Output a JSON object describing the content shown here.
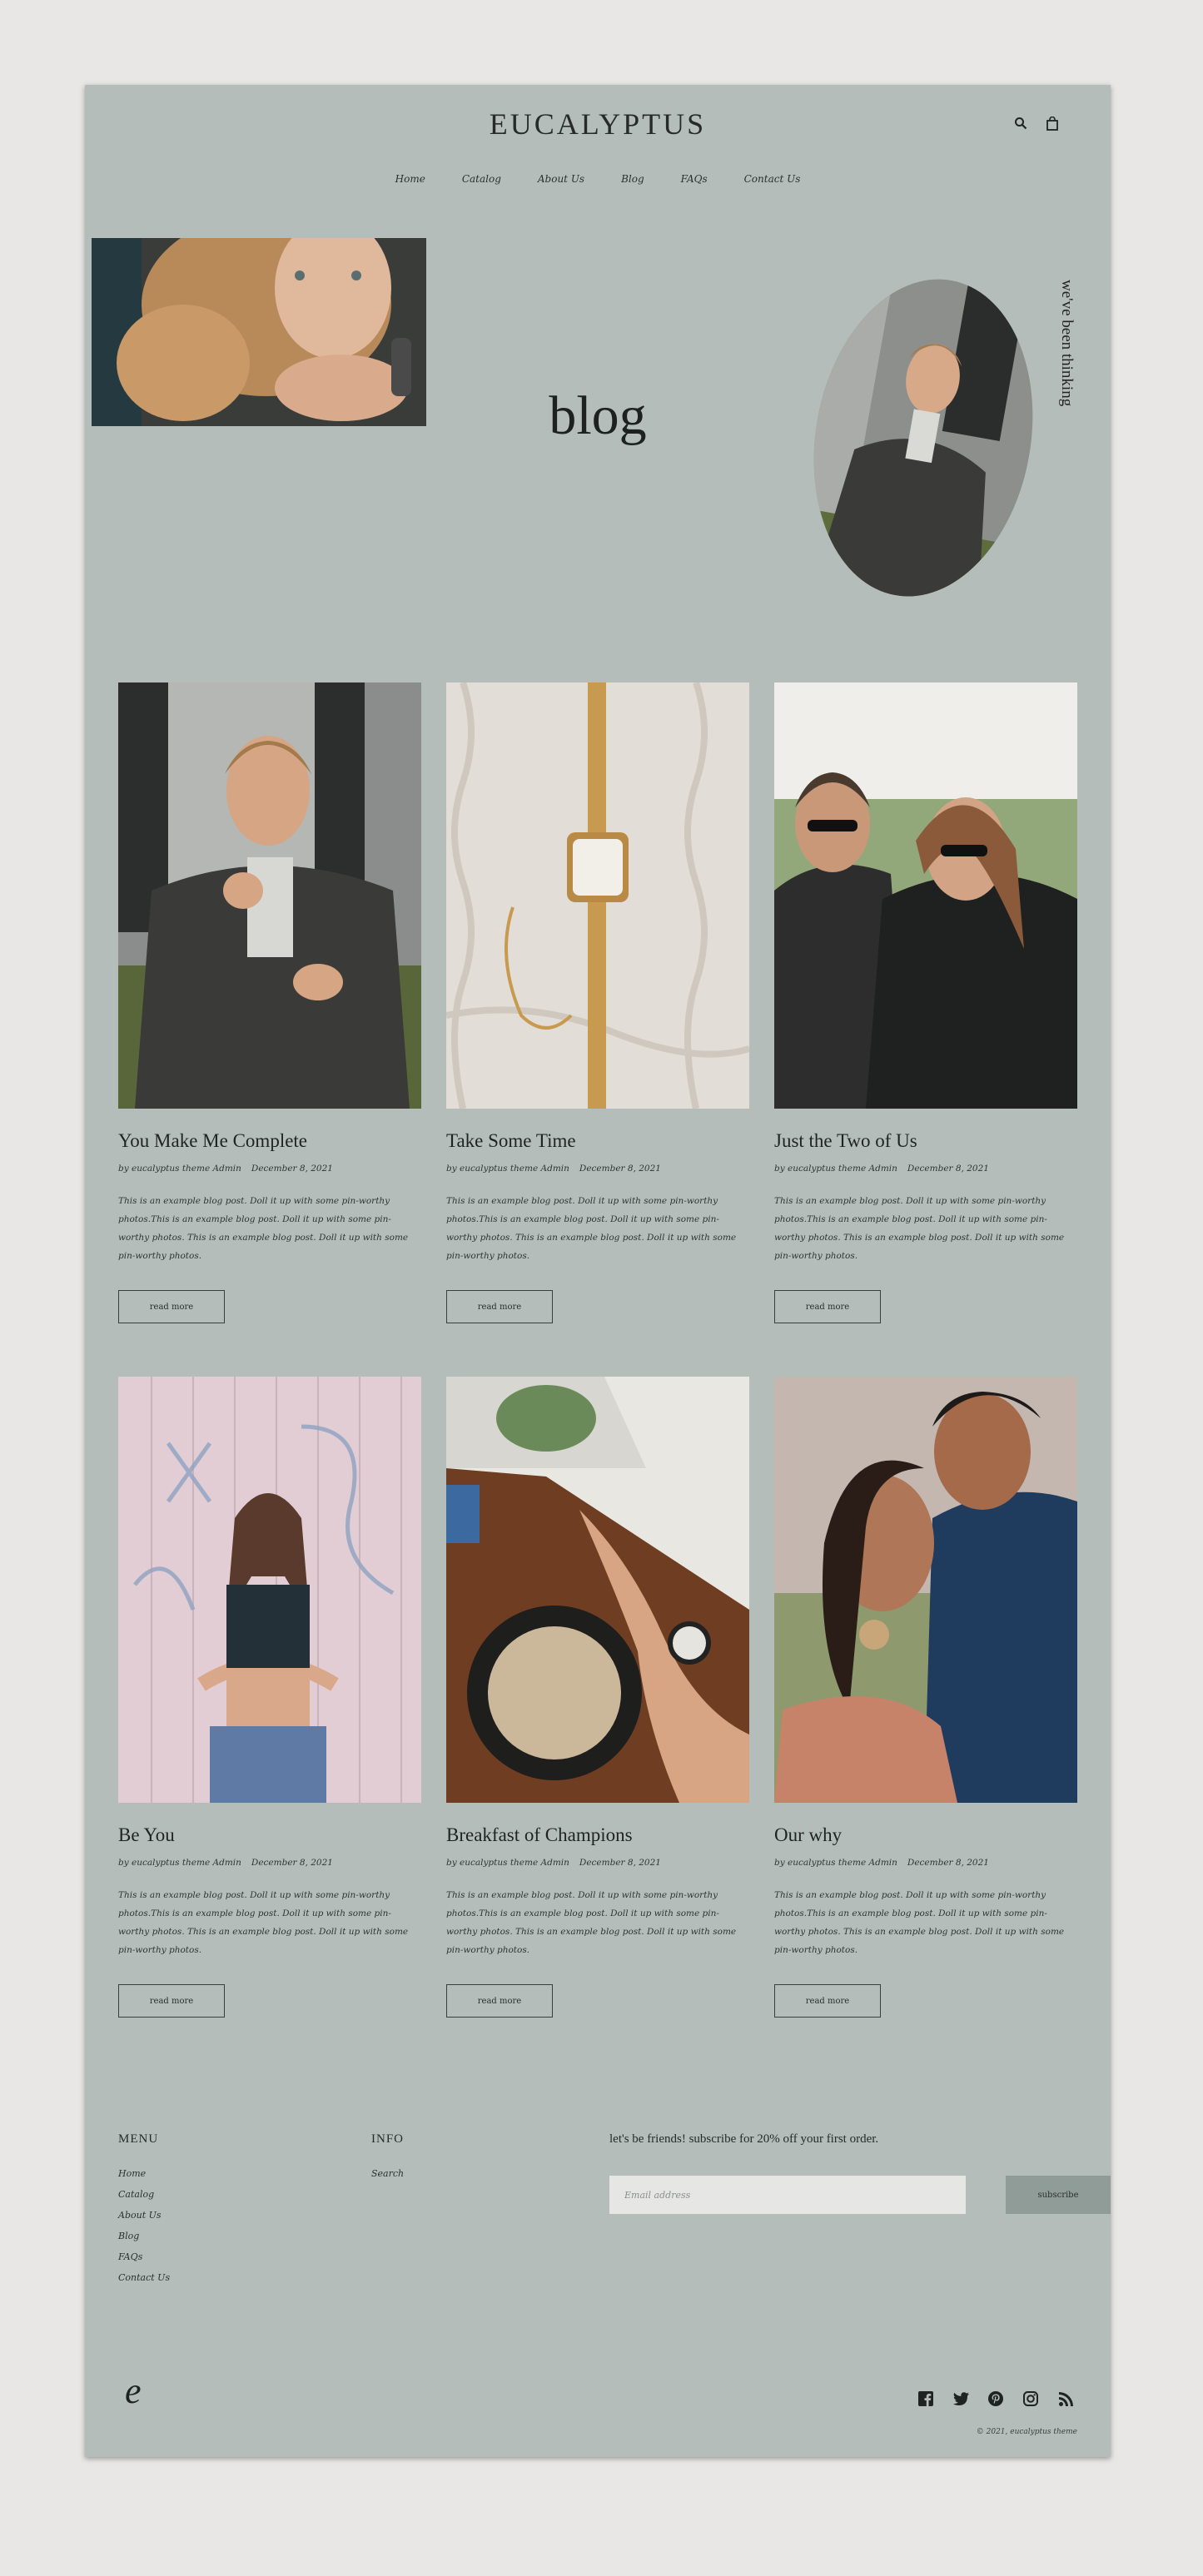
{
  "header": {
    "logo": "EUCALYPTUS",
    "nav": [
      "Home",
      "Catalog",
      "About Us",
      "Blog",
      "FAQs",
      "Contact Us"
    ]
  },
  "hero": {
    "title": "blog",
    "side_text": "we've been thinking"
  },
  "posts": [
    {
      "title": "You Make Me Complete",
      "author": "by eucalyptus theme Admin",
      "date": "December 8, 2021",
      "excerpt": "This is an example blog post. Doll it up with some pin-worthy photos.This is an example blog post. Doll it up with some pin-worthy photos. This is an example blog post. Doll it up with some pin-worthy photos.",
      "button": "read more"
    },
    {
      "title": "Take Some Time",
      "author": "by eucalyptus theme Admin",
      "date": "December 8, 2021",
      "excerpt": "This is an example blog post. Doll it up with some pin-worthy photos.This is an example blog post. Doll it up with some pin-worthy photos. This is an example blog post. Doll it up with some pin-worthy photos.",
      "button": "read more"
    },
    {
      "title": "Just the Two of Us",
      "author": "by eucalyptus theme Admin",
      "date": "December 8, 2021",
      "excerpt": "This is an example blog post. Doll it up with some pin-worthy photos.This is an example blog post. Doll it up with some pin-worthy photos. This is an example blog post. Doll it up with some pin-worthy photos.",
      "button": "read more"
    },
    {
      "title": "Be You",
      "author": "by eucalyptus theme Admin",
      "date": "December 8, 2021",
      "excerpt": "This is an example blog post. Doll it up with some pin-worthy photos.This is an example blog post. Doll it up with some pin-worthy photos. This is an example blog post. Doll it up with some pin-worthy photos.",
      "button": "read more"
    },
    {
      "title": "Breakfast of Champions",
      "author": "by eucalyptus theme Admin",
      "date": "December 8, 2021",
      "excerpt": "This is an example blog post. Doll it up with some pin-worthy photos.This is an example blog post. Doll it up with some pin-worthy photos. This is an example blog post. Doll it up with some pin-worthy photos.",
      "button": "read more"
    },
    {
      "title": "Our why",
      "author": "by eucalyptus theme Admin",
      "date": "December 8, 2021",
      "excerpt": "This is an example blog post. Doll it up with some pin-worthy photos.This is an example blog post. Doll it up with some pin-worthy photos. This is an example blog post. Doll it up with some pin-worthy photos.",
      "button": "read more"
    }
  ],
  "footer": {
    "menu_heading": "MENU",
    "menu": [
      "Home",
      "Catalog",
      "About Us",
      "Blog",
      "FAQs",
      "Contact Us"
    ],
    "info_heading": "INFO",
    "info": [
      "Search"
    ],
    "subscribe_text": "let's be friends! subscribe for 20% off your first order.",
    "email_placeholder": "Email address",
    "subscribe_button": "subscribe",
    "brand_mark": "e",
    "copyright": "© 2021, eucalyptus theme",
    "socials": [
      "facebook-icon",
      "twitter-icon",
      "pinterest-icon",
      "instagram-icon",
      "rss-icon"
    ]
  },
  "colors": {
    "background": "#b5bdbb",
    "outer": "#e8e7e5",
    "button_fill": "#8f9c98",
    "text": "#1f2422"
  }
}
